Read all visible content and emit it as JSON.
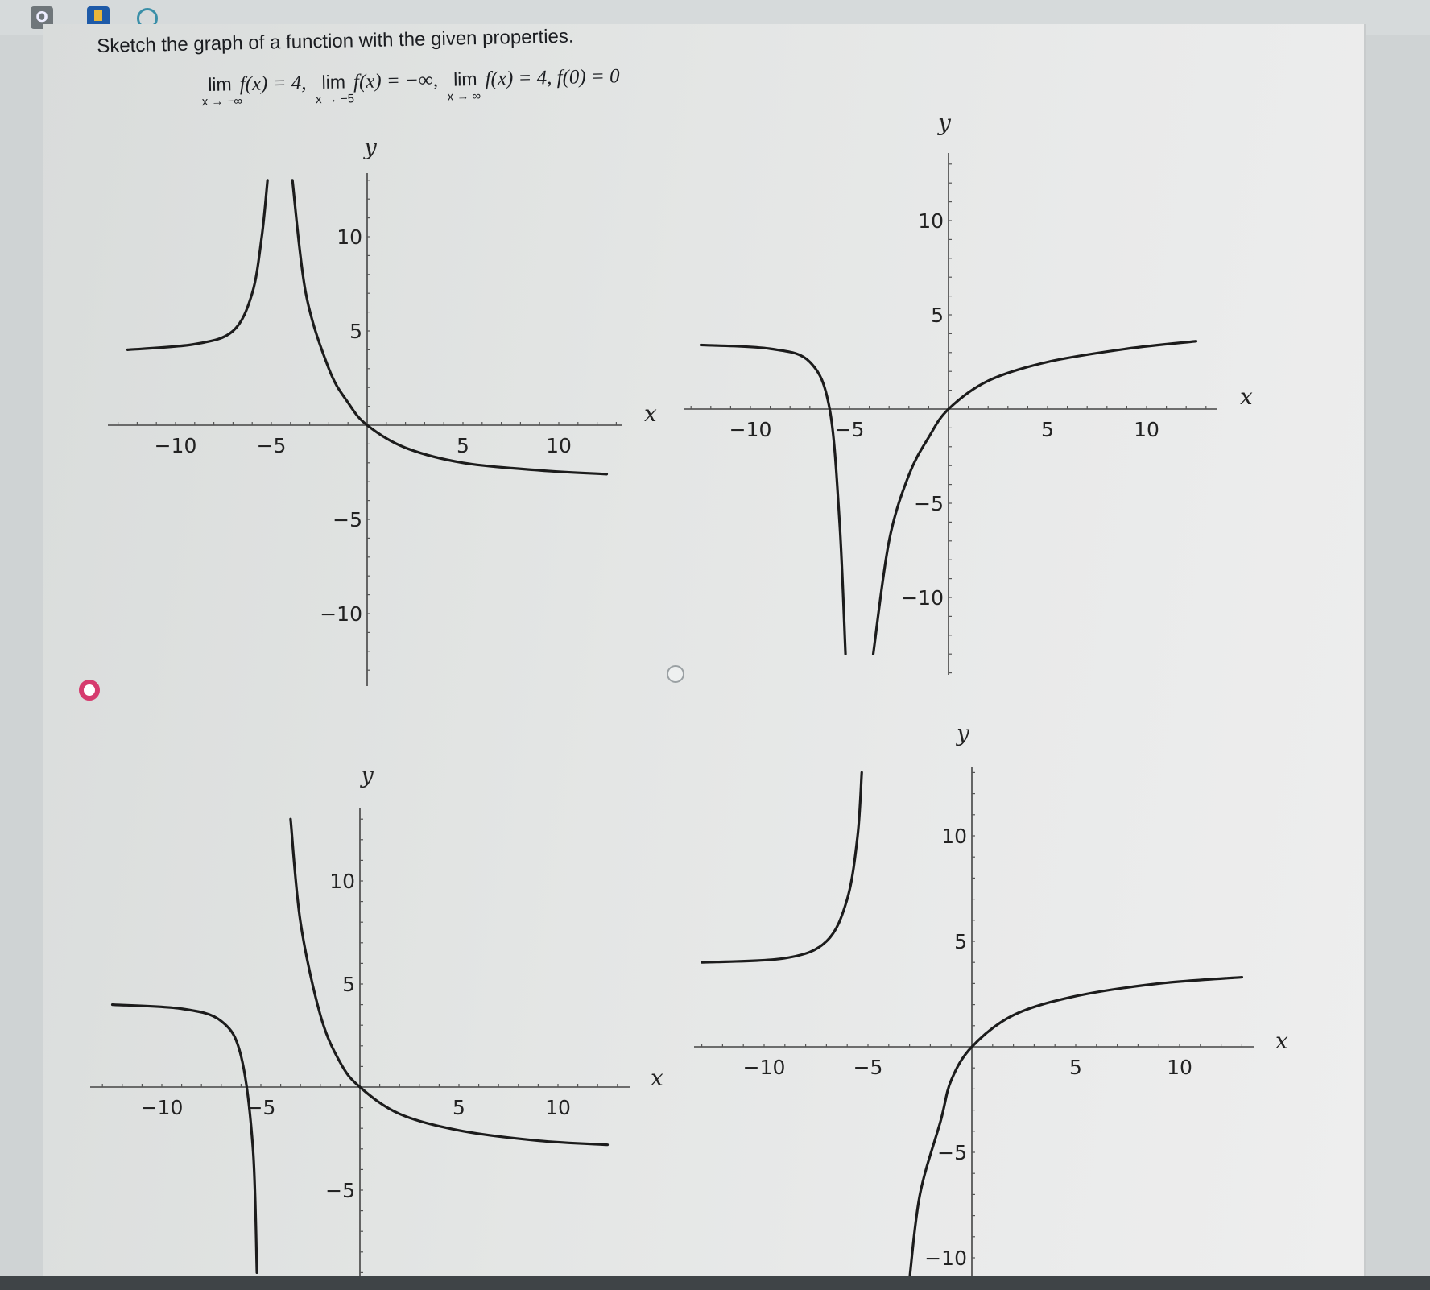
{
  "toolbar": {
    "icons": [
      "circle-o-icon",
      "flag-icon",
      "refresh-icon"
    ]
  },
  "question": {
    "prompt": "Sketch the graph of a function with the given properties.",
    "limits": [
      {
        "lim": "lim",
        "sub": "x → −∞",
        "expr": "f(x) = 4,"
      },
      {
        "lim": "lim",
        "sub": "x → −5",
        "expr": "f(x) = −∞,"
      },
      {
        "lim": "lim",
        "sub": "x → ∞",
        "expr": "f(x) = 4, f(0) = 0"
      }
    ]
  },
  "options": [
    {
      "id": "A",
      "selected": true
    },
    {
      "id": "B",
      "selected": false
    },
    {
      "id": "C",
      "selected": false
    },
    {
      "id": "D",
      "selected": false
    }
  ],
  "chart_data": [
    {
      "type": "line",
      "name": "option-top-left",
      "xlabel": "x",
      "ylabel": "y",
      "xlim": [
        -13,
        13
      ],
      "ylim": [
        -13,
        13
      ],
      "xticks": [
        "−10",
        "−5",
        "5",
        "10"
      ],
      "yticks": [
        "10",
        "5",
        "−5",
        "−10"
      ],
      "series": [
        {
          "x": [
            -12.5,
            -9,
            -7,
            -6,
            -5.5,
            -5.2
          ],
          "y": [
            4,
            4.3,
            5,
            7,
            10,
            13
          ]
        },
        {
          "x": [
            -3.9,
            -3.2,
            -2,
            -1,
            0,
            2,
            5,
            9,
            12.5
          ],
          "y": [
            13,
            7,
            3,
            1.2,
            0,
            -1.2,
            -2,
            -2.4,
            -2.6
          ]
        }
      ]
    },
    {
      "type": "line",
      "name": "option-top-right",
      "xlabel": "x",
      "ylabel": "y",
      "xlim": [
        -13,
        13
      ],
      "ylim": [
        -13,
        13
      ],
      "xticks": [
        "−10",
        "−5",
        "5",
        "10"
      ],
      "yticks": [
        "10",
        "5",
        "−5",
        "−10"
      ],
      "series": [
        {
          "x": [
            -12.5,
            -9,
            -7,
            -6,
            -5.5,
            -5.2
          ],
          "y": [
            3.4,
            3.2,
            2.5,
            0,
            -6,
            -13
          ]
        },
        {
          "x": [
            -3.8,
            -3,
            -2,
            -1,
            0,
            2,
            5,
            9,
            12.5
          ],
          "y": [
            -13,
            -7,
            -3.5,
            -1.5,
            0,
            1.5,
            2.5,
            3.2,
            3.6
          ]
        }
      ]
    },
    {
      "type": "line",
      "name": "option-bottom-left",
      "xlabel": "x",
      "ylabel": "y",
      "xlim": [
        -13,
        13
      ],
      "ylim": [
        -9,
        13
      ],
      "xticks": [
        "−10",
        "−5",
        "5",
        "10"
      ],
      "yticks": [
        "10",
        "5",
        "−5"
      ],
      "series": [
        {
          "x": [
            -12.5,
            -9,
            -7,
            -6,
            -5.4,
            -5.2
          ],
          "y": [
            4,
            3.8,
            3.2,
            1.5,
            -3,
            -9
          ]
        },
        {
          "x": [
            -3.5,
            -3,
            -2,
            -1,
            0,
            2,
            5,
            9,
            12.5
          ],
          "y": [
            13,
            8,
            3.5,
            1.2,
            0,
            -1.3,
            -2.1,
            -2.6,
            -2.8
          ]
        }
      ]
    },
    {
      "type": "line",
      "name": "option-bottom-right",
      "xlabel": "x",
      "ylabel": "y",
      "xlim": [
        -13,
        13
      ],
      "ylim": [
        -11,
        13
      ],
      "xticks": [
        "−10",
        "−5",
        "5",
        "10"
      ],
      "yticks": [
        "10",
        "5",
        "−5",
        "−10"
      ],
      "series": [
        {
          "x": [
            -13,
            -9,
            -7,
            -6,
            -5.5,
            -5.3
          ],
          "y": [
            4,
            4.2,
            5,
            7,
            10,
            13
          ]
        },
        {
          "x": [
            -3,
            -2.5,
            -1.5,
            -1,
            0,
            2,
            5,
            9,
            13
          ],
          "y": [
            -11,
            -7,
            -3.5,
            -1.6,
            0,
            1.5,
            2.4,
            3,
            3.3
          ]
        }
      ]
    }
  ]
}
